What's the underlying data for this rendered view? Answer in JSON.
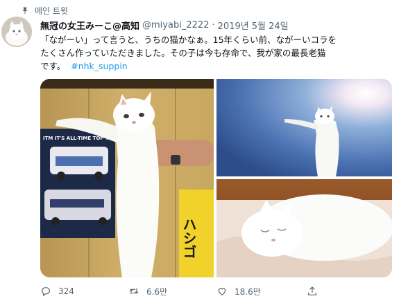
{
  "pinned": {
    "label": "메인 트윗",
    "icon": "pin-icon"
  },
  "author": {
    "display_name": "無冠の女王みーこ@高知",
    "handle": "@miyabi_2222",
    "separator": "·",
    "date": "2019년 5월 24일"
  },
  "tweet": {
    "text_lines": [
      "「ながーい」って言うと、うちの猫かなぁ。15年くらい前、ながーいコラを",
      "たくさん作っていただきました。その子は今も存命で、我が家の最長老猫",
      "です。"
    ],
    "hashtag": "#nhk_suppin"
  },
  "media": {
    "images": [
      "long-cat-held-up-photo",
      "long-cat-in-sky-photo",
      "sleeping-white-cat-photo"
    ],
    "poster_text_1": "ITM  IT'S ALL-TIME TOP TEAM",
    "poster_text_2": "ハシゴ"
  },
  "actions": {
    "reply_count": "324",
    "retweet_count": "6.6만",
    "like_count": "18.6만",
    "share_label": ""
  },
  "colors": {
    "accent": "#1d9bf0",
    "muted": "#536471",
    "text": "#0f1419"
  }
}
